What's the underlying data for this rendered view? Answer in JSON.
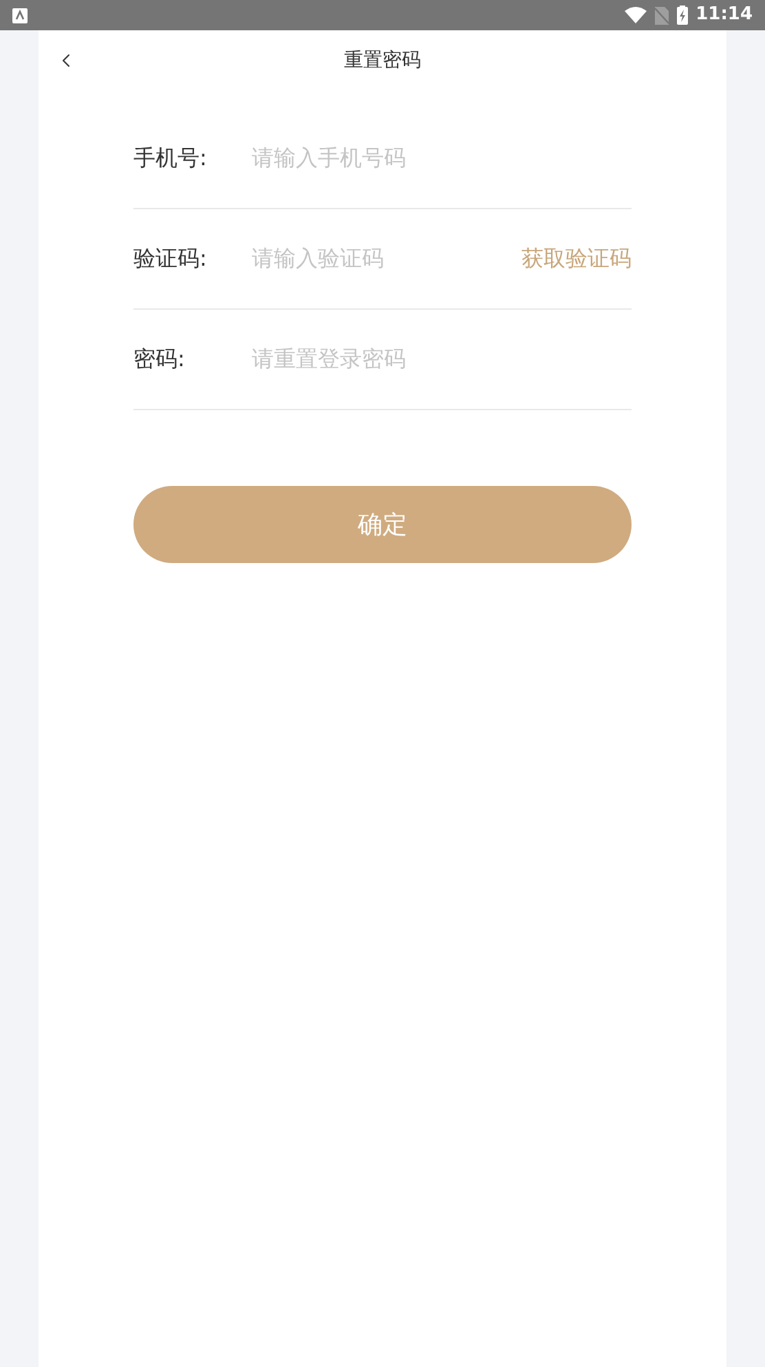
{
  "status_bar": {
    "time": "11:14"
  },
  "header": {
    "title": "重置密码"
  },
  "fields": [
    {
      "label": "手机号:",
      "placeholder": "请输入手机号码"
    },
    {
      "label": "验证码:",
      "placeholder": "请输入验证码",
      "action": "获取验证码"
    },
    {
      "label": "密码:",
      "placeholder": "请重置登录密码"
    }
  ],
  "submit": {
    "label": "确定"
  }
}
